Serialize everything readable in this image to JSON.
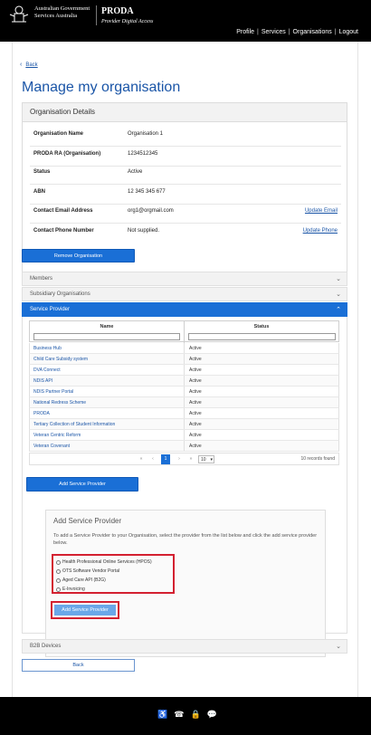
{
  "header": {
    "gov_line1": "Australian Government",
    "gov_line2": "Services Australia",
    "brand": "PRODA",
    "brand_sub": "Provider Digital Access",
    "nav": [
      "Profile",
      "Services",
      "Organisations",
      "Logout"
    ]
  },
  "back_label": "Back",
  "page_title": "Manage my organisation",
  "details": {
    "heading": "Organisation Details",
    "rows": [
      {
        "label": "Organisation Name",
        "value": "Organisation 1",
        "action": ""
      },
      {
        "label": "PRODA RA (Organisation)",
        "value": "1234512345",
        "action": ""
      },
      {
        "label": "Status",
        "value": "Active",
        "action": ""
      },
      {
        "label": "ABN",
        "value": "12 345 345 677",
        "action": ""
      },
      {
        "label": "Contact Email Address",
        "value": "org1@orgmail.com",
        "action": "Update Email"
      },
      {
        "label": "Contact Phone Number",
        "value": "Not supplied.",
        "action": "Update Phone"
      }
    ]
  },
  "remove_button": "Remove Organisation",
  "accordions": {
    "members": "Members",
    "subsidiary": "Subsidiary Organisations",
    "service_provider": "Service Provider",
    "b2b": "B2B Devices"
  },
  "table": {
    "col_name": "Name",
    "col_status": "Status",
    "rows": [
      {
        "name": "Business Hub",
        "status": "Active"
      },
      {
        "name": "Child Care Subsidy system",
        "status": "Active"
      },
      {
        "name": "DVA Connect",
        "status": "Active"
      },
      {
        "name": "NDIS API",
        "status": "Active"
      },
      {
        "name": "NDIS Partner Portal",
        "status": "Active"
      },
      {
        "name": "National Redress Scheme",
        "status": "Active"
      },
      {
        "name": "PRODA",
        "status": "Active"
      },
      {
        "name": "Tertiary Collection of Student Information",
        "status": "Active"
      },
      {
        "name": "Veteran Centric Reform",
        "status": "Active"
      },
      {
        "name": "Veteran Covenant",
        "status": "Active"
      }
    ],
    "pager": {
      "first": "«",
      "prev": "‹",
      "current": "1",
      "next": "›",
      "last": "»",
      "page_size": "10",
      "count": "10 records found"
    }
  },
  "add_service_provider_button": "Add Service Provider",
  "add_panel": {
    "title": "Add Service Provider",
    "description": "To add a Service Provider to your Organisation, select the provider from the list below and click the add service provider below.",
    "options": [
      "Health Professional Online Services (HPOS)",
      "OTS Software Vendor Portal",
      "Aged Care API (B2G)",
      "E-Invoicing"
    ],
    "submit": "Add Service Provider"
  },
  "back_button": "Back",
  "footer_icons": [
    "accessibility-icon",
    "phone-icon",
    "lock-icon",
    "chat-icon"
  ],
  "colors": {
    "primary": "#1a6fd6",
    "link": "#1a55a7",
    "highlight": "#d32030"
  }
}
